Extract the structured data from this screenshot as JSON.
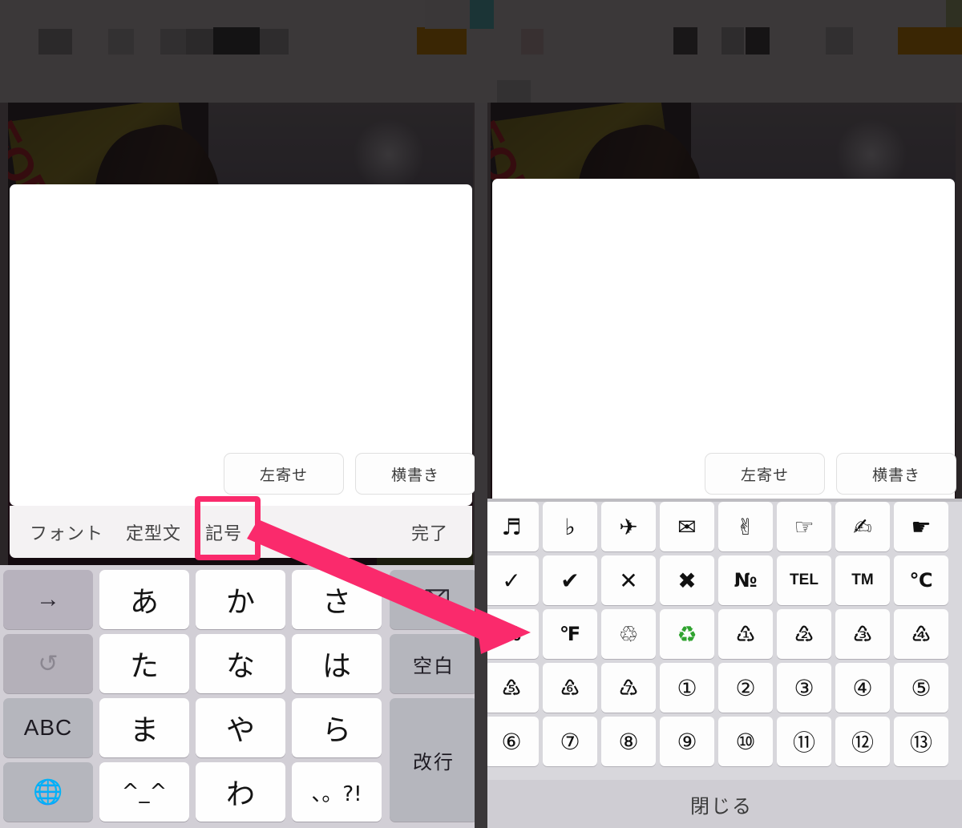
{
  "app": {
    "photo_text": "FORE"
  },
  "editor": {
    "align_button": "左寄せ",
    "writing_button": "横書き",
    "toolbar": {
      "font": "フォント",
      "template": "定型文",
      "symbol": "記号",
      "done": "完了"
    }
  },
  "annotation": {
    "highlight_target": "記号",
    "arrow_color": "#fa2a6c",
    "highlight_color": "#fa2a6c"
  },
  "kana_keyboard": {
    "rows": [
      [
        {
          "label": "→",
          "name": "cursor-right-key",
          "type": "fn"
        },
        {
          "label": "あ",
          "name": "kana-key-a",
          "type": "white"
        },
        {
          "label": "か",
          "name": "kana-key-ka",
          "type": "white"
        },
        {
          "label": "さ",
          "name": "kana-key-sa",
          "type": "white"
        },
        {
          "label": "⌫",
          "name": "delete-key",
          "type": "grey"
        }
      ],
      [
        {
          "label": "↺",
          "name": "undo-key",
          "type": "fn2"
        },
        {
          "label": "た",
          "name": "kana-key-ta",
          "type": "white"
        },
        {
          "label": "な",
          "name": "kana-key-na",
          "type": "white"
        },
        {
          "label": "は",
          "name": "kana-key-ha",
          "type": "white"
        },
        {
          "label": "空白",
          "name": "space-key",
          "type": "grey"
        }
      ],
      [
        {
          "label": "ABC",
          "name": "abc-mode-key",
          "type": "grey"
        },
        {
          "label": "ま",
          "name": "kana-key-ma",
          "type": "white"
        },
        {
          "label": "や",
          "name": "kana-key-ya",
          "type": "white"
        },
        {
          "label": "ら",
          "name": "kana-key-ra",
          "type": "white"
        },
        {
          "label": "改行",
          "name": "return-key",
          "type": "grey"
        }
      ],
      [
        {
          "label": "🌐",
          "name": "globe-key",
          "type": "grey"
        },
        {
          "label": "^_^",
          "name": "kaomoji-key",
          "type": "white"
        },
        {
          "label": "わ",
          "name": "kana-key-wa",
          "type": "white"
        },
        {
          "label": "、。?!",
          "name": "punctuation-key",
          "type": "white"
        },
        {
          "label": "",
          "name": "spacer",
          "type": "none"
        }
      ]
    ]
  },
  "symbol_keyboard": {
    "rows": [
      [
        {
          "glyph": "♬",
          "name": "music-notes-symbol-key"
        },
        {
          "glyph": "♭",
          "name": "flat-note-symbol-key"
        },
        {
          "glyph": "✈",
          "name": "airplane-symbol-key"
        },
        {
          "glyph": "✉",
          "name": "envelope-symbol-key"
        },
        {
          "glyph": "✌",
          "name": "victory-hand-symbol-key"
        },
        {
          "glyph": "☞",
          "name": "pointing-hand-symbol-key"
        },
        {
          "glyph": "✍",
          "name": "writing-hand-symbol-key"
        },
        {
          "glyph": "☛",
          "name": "black-pointer-symbol-key"
        }
      ],
      [
        {
          "glyph": "✓",
          "name": "check-mark-symbol-key"
        },
        {
          "glyph": "✔",
          "name": "heavy-check-mark-symbol-key"
        },
        {
          "glyph": "✕",
          "name": "multiplication-x-symbol-key"
        },
        {
          "glyph": "✖",
          "name": "heavy-x-symbol-key"
        },
        {
          "glyph": "№",
          "name": "numero-symbol-key"
        },
        {
          "glyph": "TEL",
          "name": "telephone-symbol-key"
        },
        {
          "glyph": "TM",
          "name": "trademark-symbol-key"
        },
        {
          "glyph": "℃",
          "name": "celsius-symbol-key"
        }
      ],
      [
        {
          "glyph": "%",
          "name": "percent-symbol-key"
        },
        {
          "glyph": "℉",
          "name": "fahrenheit-symbol-key"
        },
        {
          "glyph": "♲",
          "name": "recycle-outline-symbol-key"
        },
        {
          "glyph": "♻",
          "name": "recycle-green-symbol-key"
        },
        {
          "glyph": "♳",
          "name": "recycle-1-symbol-key"
        },
        {
          "glyph": "♴",
          "name": "recycle-2-symbol-key"
        },
        {
          "glyph": "♵",
          "name": "recycle-3-symbol-key"
        },
        {
          "glyph": "♶",
          "name": "recycle-4-symbol-key"
        }
      ],
      [
        {
          "glyph": "♷",
          "name": "recycle-5-symbol-key"
        },
        {
          "glyph": "♸",
          "name": "recycle-6-symbol-key"
        },
        {
          "glyph": "♹",
          "name": "recycle-7-symbol-key"
        },
        {
          "glyph": "①",
          "name": "circled-1-symbol-key"
        },
        {
          "glyph": "②",
          "name": "circled-2-symbol-key"
        },
        {
          "glyph": "③",
          "name": "circled-3-symbol-key"
        },
        {
          "glyph": "④",
          "name": "circled-4-symbol-key"
        },
        {
          "glyph": "⑤",
          "name": "circled-5-symbol-key"
        }
      ],
      [
        {
          "glyph": "⑥",
          "name": "circled-6-symbol-key"
        },
        {
          "glyph": "⑦",
          "name": "circled-7-symbol-key"
        },
        {
          "glyph": "⑧",
          "name": "circled-8-symbol-key"
        },
        {
          "glyph": "⑨",
          "name": "circled-9-symbol-key"
        },
        {
          "glyph": "⑩",
          "name": "circled-10-symbol-key"
        },
        {
          "glyph": "⑪",
          "name": "circled-11-symbol-key"
        },
        {
          "glyph": "⑫",
          "name": "circled-12-symbol-key"
        },
        {
          "glyph": "⑬",
          "name": "circled-13-symbol-key"
        }
      ]
    ],
    "close_label": "閉じる"
  }
}
